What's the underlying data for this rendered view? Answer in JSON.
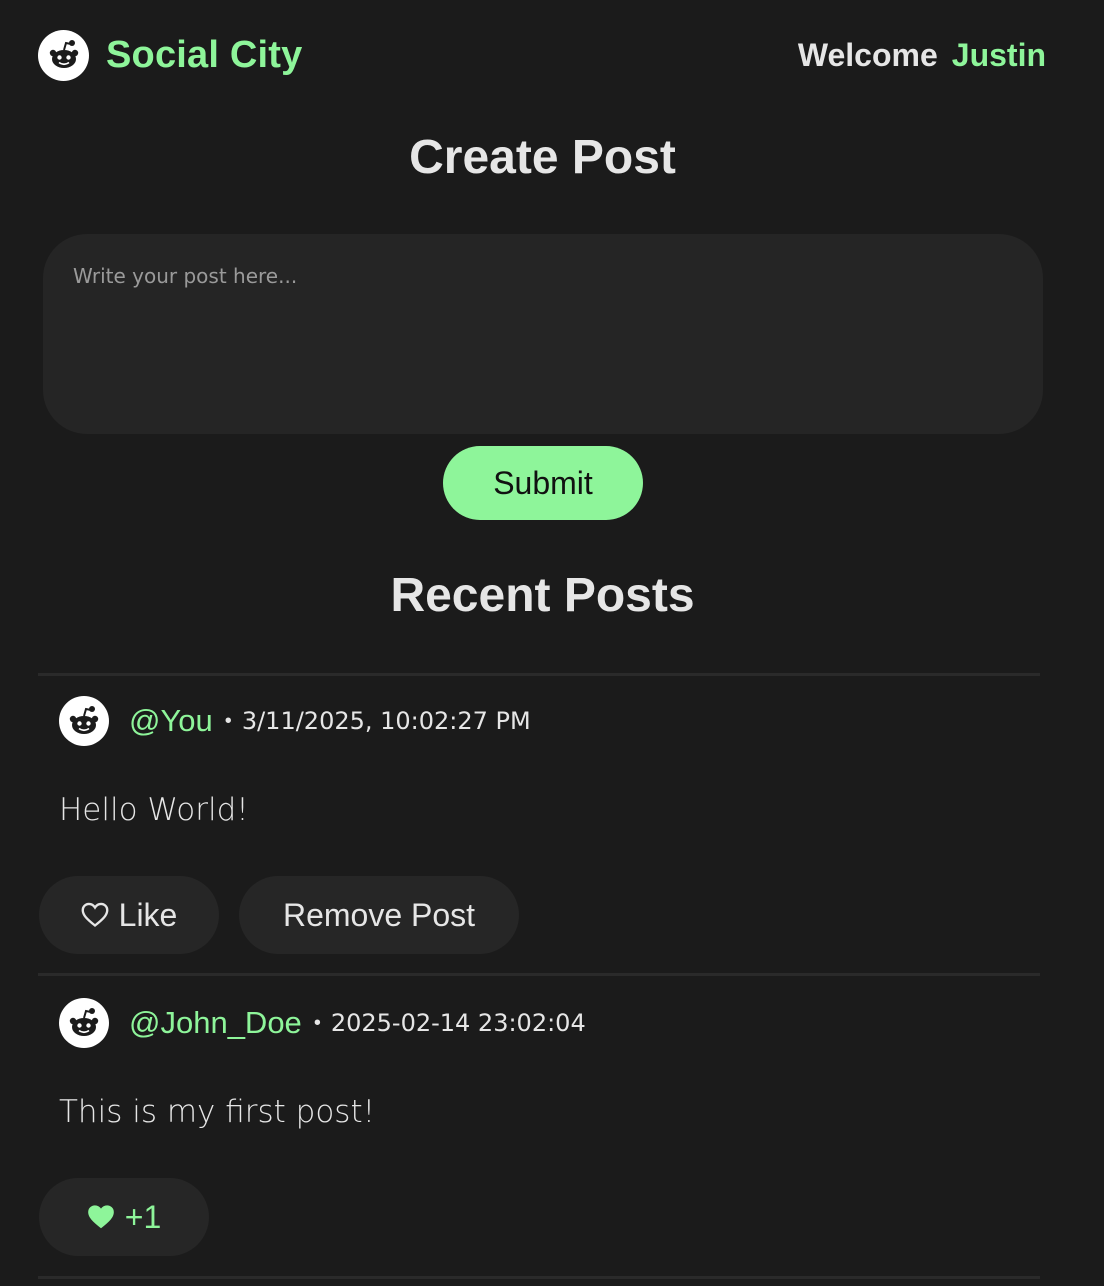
{
  "header": {
    "brand_name": "Social City",
    "logo_icon": "alien-mascot-icon",
    "welcome_label": "Welcome",
    "username": "Justin"
  },
  "create": {
    "title": "Create Post",
    "placeholder": "Write your post here...",
    "value": "",
    "submit_label": "Submit"
  },
  "feed": {
    "title": "Recent Posts",
    "posts": [
      {
        "handle": "@You",
        "separator": "•",
        "timestamp": "3/11/2025, 10:02:27 PM",
        "body": "Hello World!",
        "like_label": "Like",
        "like_icon": "heart-outline-icon",
        "remove_label": "Remove Post"
      },
      {
        "handle": "@John_Doe",
        "separator": "•",
        "timestamp": "2025-02-14 23:02:04",
        "body": "This is my first post!",
        "like_label": "+1",
        "like_icon": "heart-filled-icon"
      }
    ]
  },
  "colors": {
    "background": "#1b1b1b",
    "accent": "#8ef59a",
    "surface": "#262626",
    "text": "#e6e6e6"
  }
}
